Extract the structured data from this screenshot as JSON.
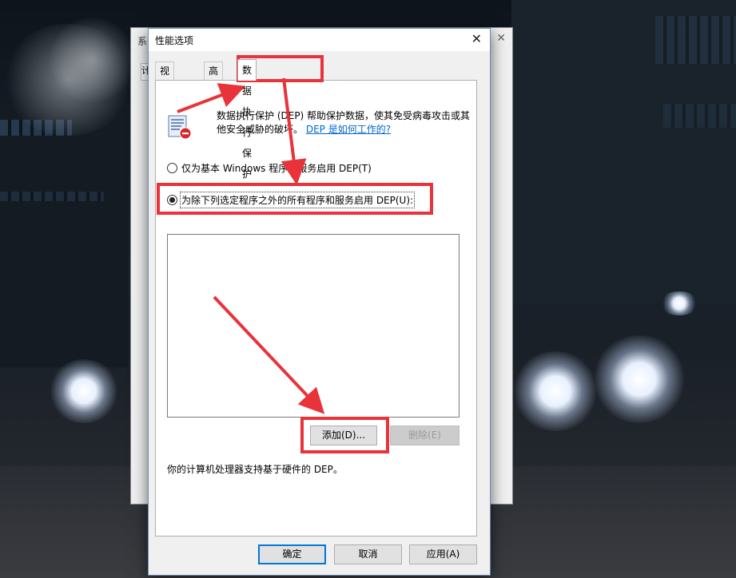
{
  "back_window": {
    "title": "系",
    "close_glyph": "✕",
    "tab_glyph": "计"
  },
  "dialog": {
    "title": "性能选项",
    "close_glyph": "✕",
    "tabs": [
      {
        "label": "视觉效果"
      },
      {
        "label": "高级"
      },
      {
        "label": "数据执行保护"
      }
    ],
    "description_text": "数据执行保护 (DEP) 帮助保护数据，使其免受病毒攻击或其他安全威胁的破坏。",
    "description_link": "DEP 是如何工作的?",
    "radio_options": [
      {
        "label": "仅为基本 Windows 程序和服务启用 DEP(T)",
        "checked": false
      },
      {
        "label": "为除下列选定程序之外的所有程序和服务启用 DEP(U):",
        "checked": true
      }
    ],
    "add_button": "添加(D)...",
    "remove_button": "删除(E)",
    "hardware_note": "你的计算机处理器支持基于硬件的 DEP。",
    "ok_button": "确定",
    "cancel_button": "取消",
    "apply_button": "应用(A)"
  },
  "icons": {
    "dep_icon": "dep-shield-document-icon",
    "close_icon": "close-icon"
  },
  "colors": {
    "annotation_red": "#e8333a",
    "link_blue": "#0066cc",
    "focus_blue": "#0078d7"
  }
}
